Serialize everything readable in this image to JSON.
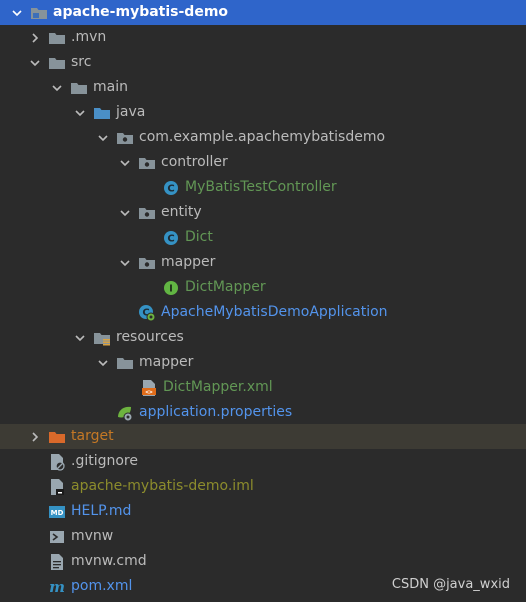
{
  "project_tree": {
    "root": {
      "label": "apache-mybatis-demo",
      "expanded": true,
      "selected": true
    },
    "mvn": {
      "label": ".mvn",
      "expanded": false
    },
    "src": {
      "label": "src",
      "expanded": true
    },
    "main": {
      "label": "main",
      "expanded": true
    },
    "java": {
      "label": "java",
      "expanded": true
    },
    "package": {
      "label": "com.example.apachemybatisdemo",
      "expanded": true
    },
    "controller": {
      "label": "controller",
      "expanded": true
    },
    "controller_class": {
      "label": "MyBatisTestController"
    },
    "entity": {
      "label": "entity",
      "expanded": true
    },
    "entity_class": {
      "label": "Dict"
    },
    "mapper_pkg": {
      "label": "mapper",
      "expanded": true
    },
    "mapper_interface": {
      "label": "DictMapper"
    },
    "app_class": {
      "label": "ApacheMybatisDemoApplication"
    },
    "resources": {
      "label": "resources",
      "expanded": true
    },
    "mapper_res": {
      "label": "mapper",
      "expanded": true
    },
    "mapper_xml": {
      "label": "DictMapper.xml"
    },
    "app_props": {
      "label": "application.properties"
    },
    "target": {
      "label": "target",
      "expanded": false
    },
    "gitignore": {
      "label": ".gitignore"
    },
    "iml": {
      "label": "apache-mybatis-demo.iml"
    },
    "help": {
      "label": "HELP.md"
    },
    "mvnw": {
      "label": "mvnw"
    },
    "mvnw_cmd": {
      "label": "mvnw.cmd"
    },
    "pom": {
      "label": "pom.xml"
    }
  },
  "watermark": "CSDN @java_wxid",
  "colors": {
    "background": "#2b2b2b",
    "selection": "#2f65ca",
    "excluded_row": "#3d3b34",
    "modified_text": "#629755",
    "new_file_text": "#5394ec",
    "unversioned_text": "#8c8c2c",
    "excluded_text": "#c57825"
  }
}
